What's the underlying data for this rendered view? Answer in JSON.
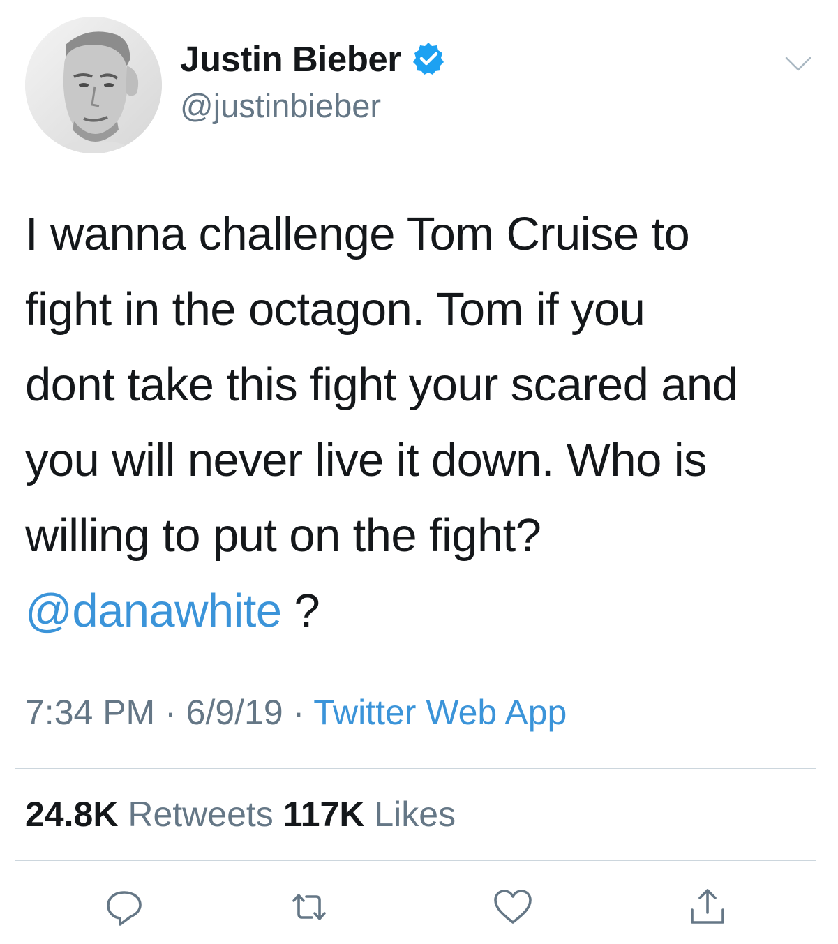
{
  "author": {
    "name": "Justin Bieber",
    "handle": "@justinbieber",
    "verified": true,
    "avatar_icon": "profile-photo"
  },
  "menu": {
    "icon": "chevron-down-icon"
  },
  "tweet": {
    "lines": [
      "I wanna challenge Tom Cruise to",
      "fight in the octagon. Tom if you",
      "dont take this fight your scared and",
      "you will never live it down. Who is",
      "willing to put on the fight?"
    ],
    "mention": "@danawhite",
    "mention_suffix": " ?"
  },
  "meta": {
    "time": "7:34 PM",
    "separator": " · ",
    "date": "6/9/19",
    "source": "Twitter Web App"
  },
  "stats": {
    "retweets_count": "24.8K",
    "retweets_label": "Retweets",
    "likes_count": "117K",
    "likes_label": "Likes"
  },
  "actions": [
    {
      "name": "reply",
      "icon": "reply-icon"
    },
    {
      "name": "retweet",
      "icon": "retweet-icon"
    },
    {
      "name": "like",
      "icon": "heart-icon"
    },
    {
      "name": "share",
      "icon": "share-icon"
    }
  ],
  "colors": {
    "text": "#14171a",
    "secondary": "#657786",
    "link": "#3b94d9",
    "verified": "#1da1f2",
    "divider": "#ccd6dd"
  }
}
